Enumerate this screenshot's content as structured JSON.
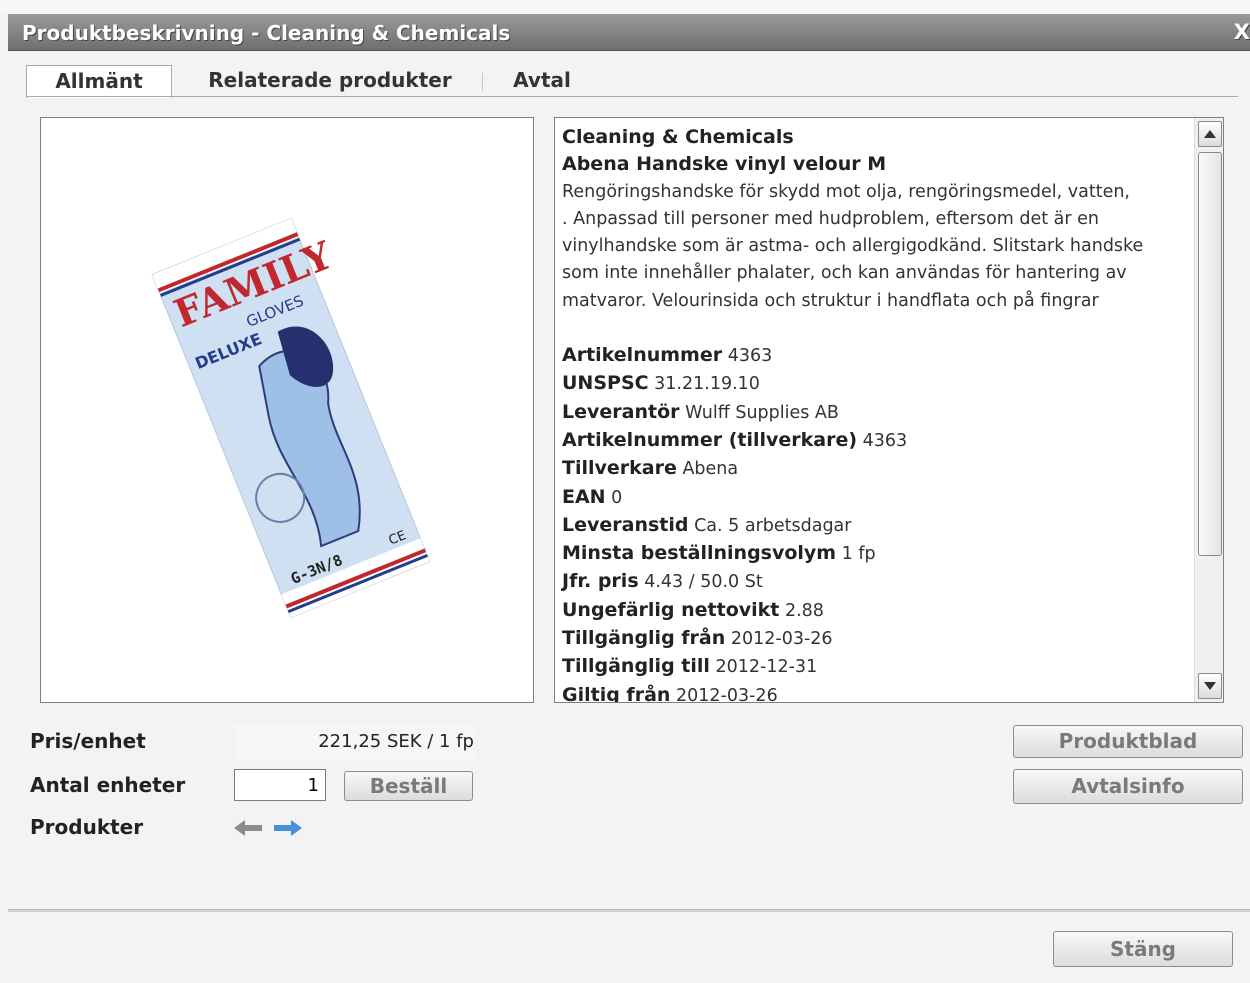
{
  "window": {
    "title": "Produktbeskrivning - Cleaning & Chemicals",
    "close": "X"
  },
  "tabs": [
    {
      "label": "Allmänt",
      "active": true
    },
    {
      "label": "Relaterade produkter",
      "active": false
    },
    {
      "label": "Avtal",
      "active": false
    }
  ],
  "product": {
    "category": "Cleaning & Chemicals",
    "name": "Abena Handske vinyl velour M",
    "description": [
      "Rengöringshandske för skydd mot olja, rengöringsmedel, vatten,",
      ". Anpassad till personer med hudproblem, eftersom det är en",
      "vinylhandske som är astma- och allergigodkänd. Slitstark handske",
      "som inte innehåller phalater, och kan användas för hantering av",
      "matvaror. Velourinsida och struktur i handflata och på fingrar"
    ],
    "attributes": [
      {
        "label": "Artikelnummer",
        "value": "4363"
      },
      {
        "label": "UNSPSC",
        "value": "31.21.19.10"
      },
      {
        "label": "Leverantör",
        "value": "Wulff Supplies AB"
      },
      {
        "label": "Artikelnummer (tillverkare)",
        "value": "4363"
      },
      {
        "label": "Tillverkare",
        "value": "Abena"
      },
      {
        "label": "EAN",
        "value": "0"
      },
      {
        "label": "Leveranstid",
        "value": "Ca. 5 arbetsdagar"
      },
      {
        "label": "Minsta beställningsvolym",
        "value": "1 fp"
      },
      {
        "label": "Jfr. pris",
        "value": "4.43  / 50.0 St"
      },
      {
        "label": "Ungefärlig nettovikt",
        "value": "2.88"
      },
      {
        "label": "Tillgänglig från",
        "value": "2012-03-26"
      },
      {
        "label": "Tillgänglig till",
        "value": "2012-12-31"
      },
      {
        "label": "Giltig från",
        "value": "2012-03-26"
      }
    ],
    "packaging_text": {
      "brand": "FAMILY",
      "sub": "GLOVES",
      "line": "DELUXE",
      "size": "G-3N/8",
      "mark": "CE"
    }
  },
  "order": {
    "price_label": "Pris/enhet",
    "price_value": "221,25 SEK  / 1 fp",
    "qty_label": "Antal enheter",
    "qty_value": "1",
    "order_button": "Beställ",
    "products_label": "Produkter"
  },
  "side_buttons": {
    "product_sheet": "Produktblad",
    "agreement_info": "Avtalsinfo"
  },
  "footer": {
    "close_button": "Stäng"
  },
  "colors": {
    "title_bar": "#7f7f7f",
    "arrow_blue": "#4a90d9",
    "arrow_gray": "#8c8c8c"
  }
}
